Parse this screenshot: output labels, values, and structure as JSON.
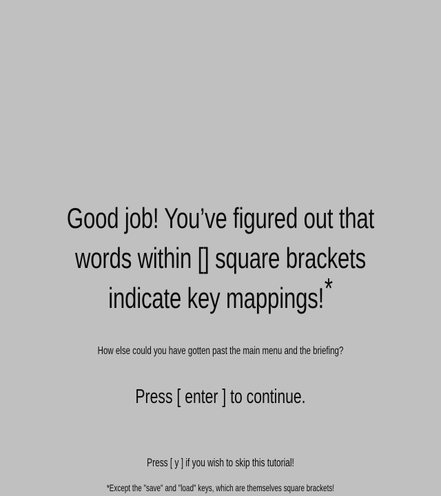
{
  "background_color": "#c0c0c0",
  "text_color": "#0a0a0a",
  "headline": {
    "line1": "Good job! You’ve figured out that",
    "line2": "words within [] square brackets",
    "line3": "indicate key mappings!",
    "asterisk": "*"
  },
  "question": "How else could you have gotten past the main menu and the briefing?",
  "continue_prompt": "Press [ enter ] to continue.",
  "skip_prompt": "Press [ y ] if you wish to skip this tutorial!",
  "footnote": "*Except the \"save\" and \"load\" keys, which are themselves square brackets!"
}
